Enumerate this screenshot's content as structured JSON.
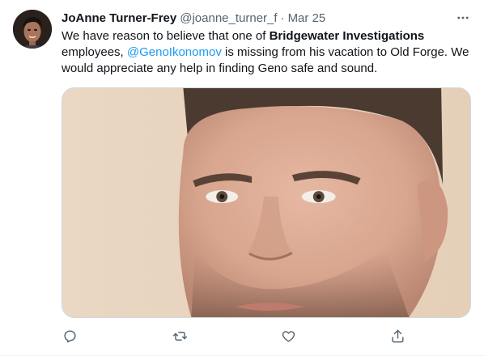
{
  "tweet": {
    "author_name": "JoAnne Turner-Frey",
    "handle": "@joanne_turner_f",
    "separator": "·",
    "date": "Mar 25",
    "text": {
      "part1": "We have reason to believe that one of ",
      "bold": "Bridgewater Investigations",
      "part2": " employees, ",
      "mention": "@GenoIkonomov",
      "part3": " is missing from his vacation to Old Forge. We would appreciate any help in finding Geno safe and sound."
    },
    "media": {
      "kind": "photo",
      "subject": "man-face-closeup"
    },
    "actions": [
      {
        "name": "reply",
        "icon": "reply-icon"
      },
      {
        "name": "retweet",
        "icon": "retweet-icon"
      },
      {
        "name": "like",
        "icon": "like-icon"
      },
      {
        "name": "share",
        "icon": "share-icon"
      }
    ]
  },
  "colors": {
    "text": "#0f1419",
    "secondary": "#536471",
    "link": "#1d9bf0",
    "border": "#cfd9de"
  }
}
